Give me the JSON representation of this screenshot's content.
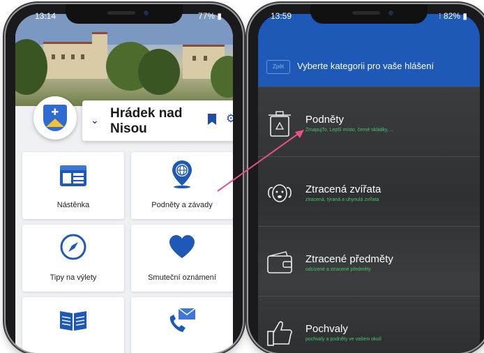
{
  "left_phone": {
    "status_time": "13:14",
    "status_battery": "77%",
    "town_name": "Hrádek nad Nisou",
    "tiles": [
      {
        "label": "Nástěnka",
        "icon": "board-icon"
      },
      {
        "label": "Podněty a závady",
        "icon": "map-pin-icon"
      },
      {
        "label": "Tipy na výlety",
        "icon": "compass-icon"
      },
      {
        "label": "Smuteční oznámení",
        "icon": "heart-icon"
      },
      {
        "label": "",
        "icon": "book-icon"
      },
      {
        "label": "",
        "icon": "phone-mail-icon"
      }
    ]
  },
  "right_phone": {
    "status_time": "13:59",
    "status_battery": "82%",
    "back_label": "Zpět",
    "header_title": "Vyberte kategorii pro vaše hlášení",
    "categories": [
      {
        "title": "Podněty",
        "subtitle": "ZmapujTo, Lepší místo, černé skládky, ...",
        "icon": "recycle-bin-icon"
      },
      {
        "title": "Ztracená zvířata",
        "subtitle": "ztracená, týraná a uhynulá zvířata",
        "icon": "dog-icon"
      },
      {
        "title": "Ztracené předměty",
        "subtitle": "odcizené a ztracené předměty",
        "icon": "wallet-icon"
      },
      {
        "title": "Pochvaly",
        "subtitle": "pochvaly a podněty ve vašem okolí",
        "icon": "thumbs-up-icon"
      }
    ]
  },
  "colors": {
    "brand_blue": "#1f59b8",
    "accent_green": "#4cc46a",
    "arrow_pink": "#e8508c"
  }
}
